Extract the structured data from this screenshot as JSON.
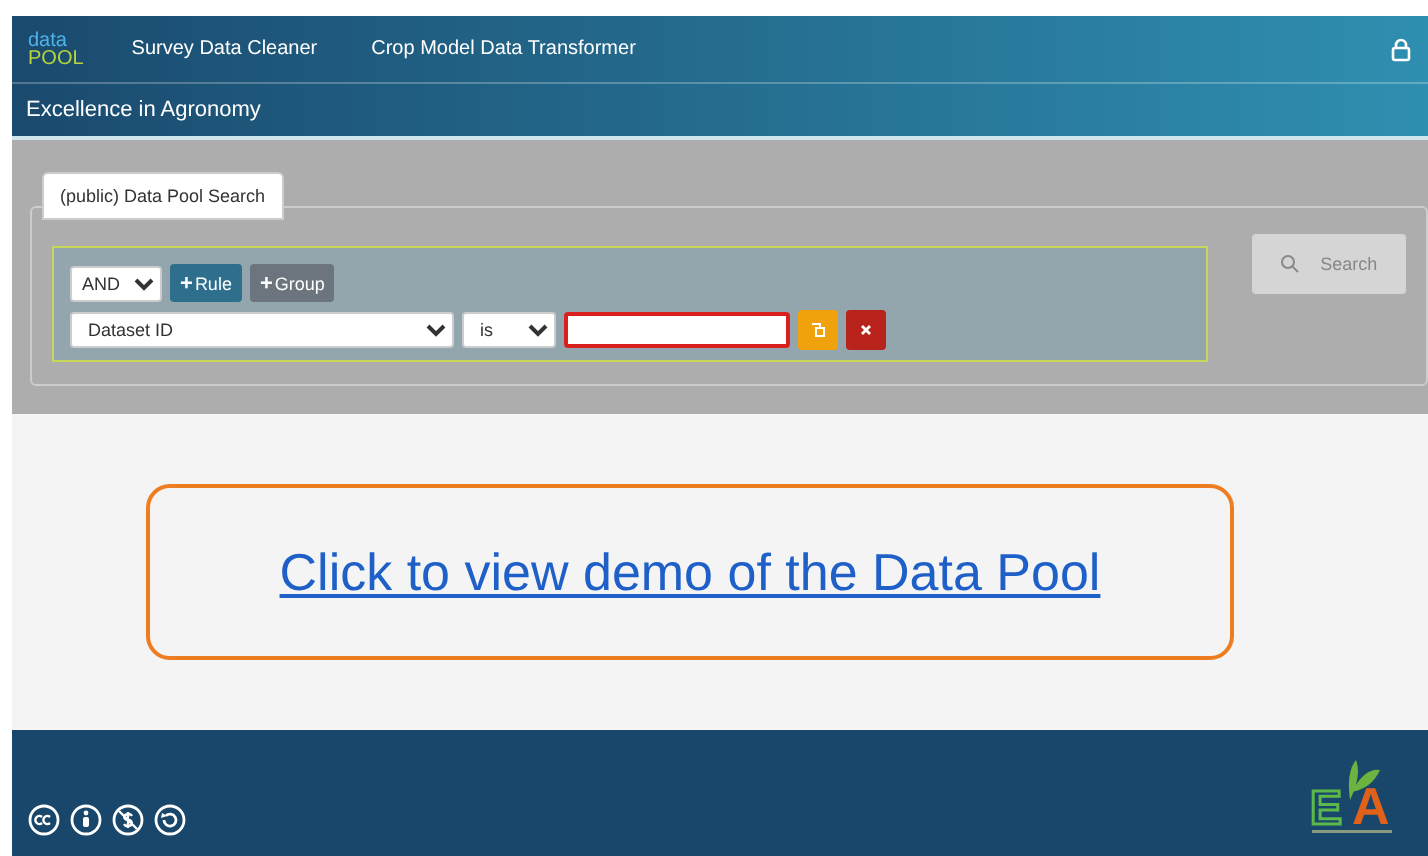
{
  "header": {
    "logo": {
      "top": "data",
      "bottom": "POOL"
    },
    "nav": [
      {
        "label": "Survey Data Cleaner"
      },
      {
        "label": "Crop Model Data Transformer"
      }
    ],
    "subtitle": "Excellence in Agronomy"
  },
  "search_panel": {
    "tab": {
      "label": "(public) Data Pool Search",
      "selected": true
    },
    "conjunction": "AND",
    "buttons": [
      {
        "icon": "+",
        "label": "Rule",
        "kind": "primary"
      },
      {
        "icon": "+",
        "label": "Group",
        "kind": "secondary"
      }
    ],
    "rule": {
      "field": "Dataset ID",
      "operator": "is",
      "value_invalid": true
    },
    "search_button": {
      "label": "Search",
      "disabled": true
    }
  },
  "demo_link": "Click to view demo of the Data Pool",
  "footer": {
    "logo": {
      "letters": [
        "E",
        "A"
      ]
    }
  }
}
